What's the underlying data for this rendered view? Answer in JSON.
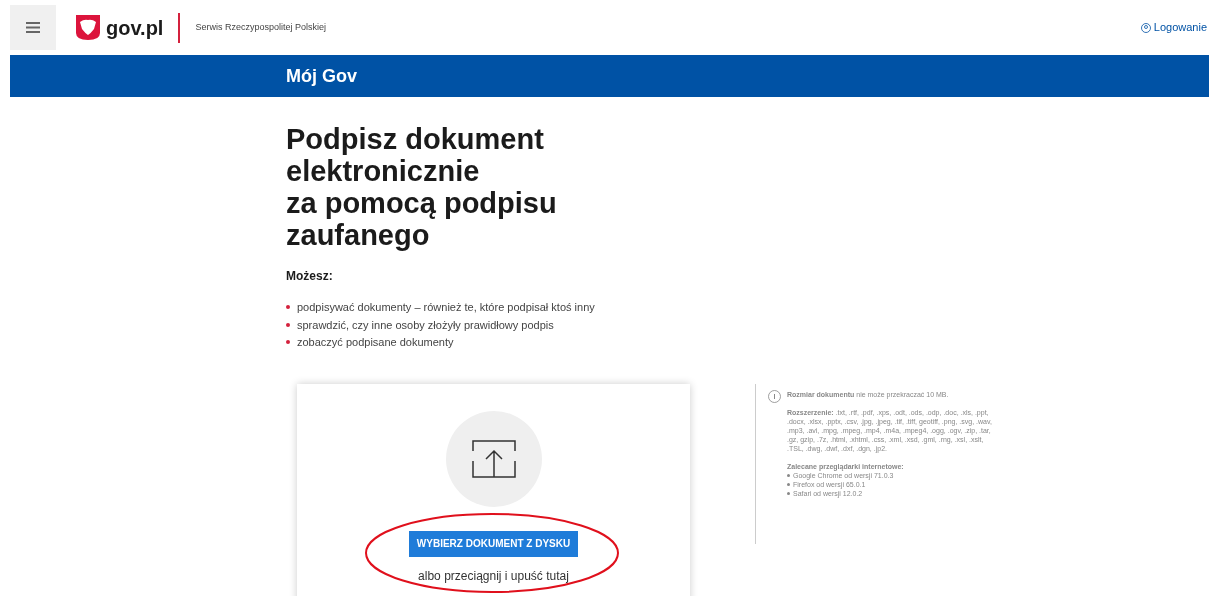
{
  "header": {
    "logo_text": "gov.pl",
    "service_name": "Serwis Rzeczypospolitej Polskiej",
    "login": "Logowanie"
  },
  "banner": {
    "title": "Mój Gov"
  },
  "heading_lines": [
    "Podpisz dokument",
    "elektronicznie",
    "za pomocą podpisu",
    "zaufanego"
  ],
  "intro": "Możesz:",
  "bullets": [
    "podpisywać dokumenty – również te, które podpisał ktoś inny",
    "sprawdzić, czy inne osoby złożyły prawidłowy podpis",
    "zobaczyć podpisane dokumenty"
  ],
  "upload": {
    "button": "WYBIERZ DOKUMENT Z DYSKU",
    "drop_hint": "albo przeciągnij i upuść tutaj"
  },
  "info": {
    "size_note": "**Rozmiar dokumentu** nie może przekraczać 10 MB.",
    "extensions": "**Rozszerzenie:** .txt, .rtf, .pdf, .xps, .odt, .ods, .odp, .doc, .xls, .ppt, .docx, .xlsx, .pptx, .csv, .jpg, .jpeg, .tif, .tiff, geotiff, .png, .svg, .wav, .mp3, .avi, .mpg, .mpeg, .mp4, .m4a, .mpeg4, .ogg, .ogv, .zip, .tar, .gz, gzip, .7z, .html, .xhtml, .css, .xml, .xsd, .gml, .rng, .xsl, .xslt, .TSL, .dwg, .dwf, .dxf, .dgn, .jp2.",
    "browsers_title": "Zalecane przeglądarki internetowe:",
    "browsers": [
      "Google Chrome od wersji 71.0.3",
      "Firefox od wersji 65.0.1",
      "Safari od wersji 12.0.2"
    ]
  }
}
